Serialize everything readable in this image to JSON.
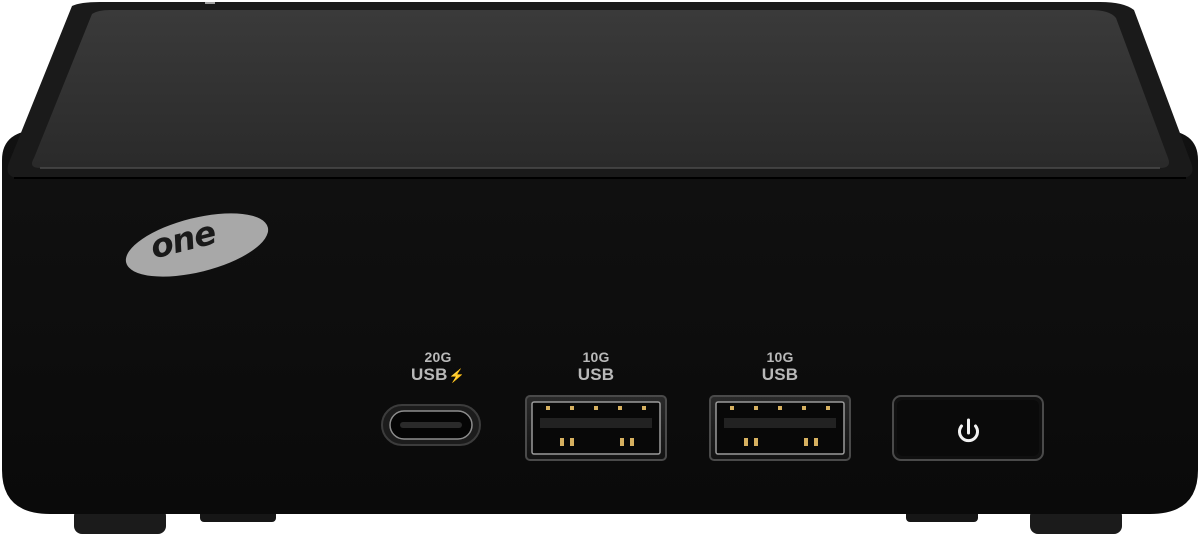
{
  "brand": {
    "logo_text": "one"
  },
  "ports": {
    "usb_c": {
      "speed": "20G",
      "protocol": "USB",
      "symbol": "⚡",
      "icon": "usb-c-port-icon"
    },
    "usb_a_1": {
      "speed": "10G",
      "protocol": "USB",
      "icon": "usb-a-port-icon"
    },
    "usb_a_2": {
      "speed": "10G",
      "protocol": "USB",
      "icon": "usb-a-port-icon"
    }
  },
  "power_button": {
    "icon": "power-icon"
  },
  "colors": {
    "body": "#0e0e0e",
    "top_panel": "#2e2e2e",
    "label": "#b9b9b9",
    "logo": "#a8a8a8"
  }
}
